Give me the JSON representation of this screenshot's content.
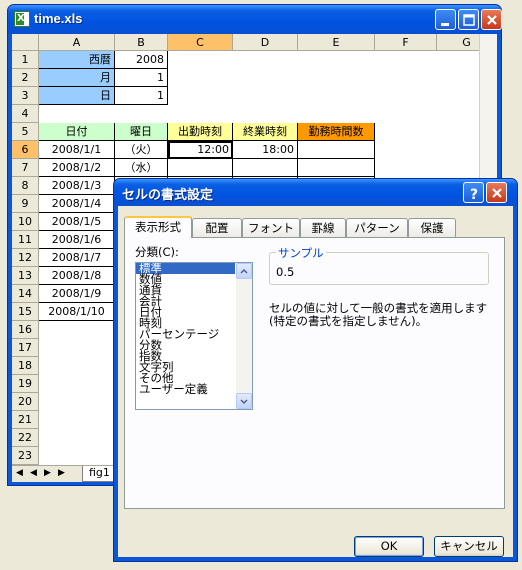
{
  "excel": {
    "title": "time.xls",
    "columns": [
      "A",
      "B",
      "C",
      "D",
      "E",
      "F",
      "G"
    ],
    "rows": [
      "1",
      "2",
      "3",
      "4",
      "5",
      "6",
      "7",
      "8",
      "9",
      "10",
      "11",
      "12",
      "13",
      "14",
      "15",
      "16",
      "17",
      "18",
      "19",
      "20",
      "21",
      "22",
      "23"
    ],
    "cells": {
      "a1": "西暦",
      "b1": "2008",
      "a2": "月",
      "b2": "1",
      "a3": "日",
      "b3": "1",
      "a5": "日付",
      "b5": "曜日",
      "c5": "出勤時刻",
      "d5": "終業時刻",
      "e5": "勤務時間数",
      "a6": "2008/1/1",
      "b6": "（火）",
      "c6": "12:00",
      "d6": "18:00",
      "a7": "2008/1/2",
      "b7": "（水）",
      "a8": "2008/1/3",
      "a9": "2008/1/4",
      "a10": "2008/1/5",
      "a11": "2008/1/6",
      "a12": "2008/1/7",
      "a13": "2008/1/8",
      "a14": "2008/1/9",
      "a15": "2008/1/10"
    },
    "sheet_tab": "fig1",
    "colors": {
      "blue_cell": "#99ccff",
      "green_header": "#ccffcc",
      "yellow_header": "#ffff99",
      "orange_header": "#ff9900"
    }
  },
  "dialog": {
    "title": "セルの書式設定",
    "tabs": [
      "表示形式",
      "配置",
      "フォント",
      "罫線",
      "パターン",
      "保護"
    ],
    "active_tab": "表示形式",
    "category_label": "分類(C):",
    "categories": [
      "標準",
      "数値",
      "通貨",
      "会計",
      "日付",
      "時刻",
      "パーセンテージ",
      "分数",
      "指数",
      "文字列",
      "その他",
      "ユーザー定義"
    ],
    "selected_category": "標準",
    "sample_label": "サンプル",
    "sample_value": "0.5",
    "description_line1": "セルの値に対して一般の書式を適用します",
    "description_line2": "(特定の書式を指定しません)。",
    "ok_label": "OK",
    "cancel_label": "キャンセル"
  }
}
